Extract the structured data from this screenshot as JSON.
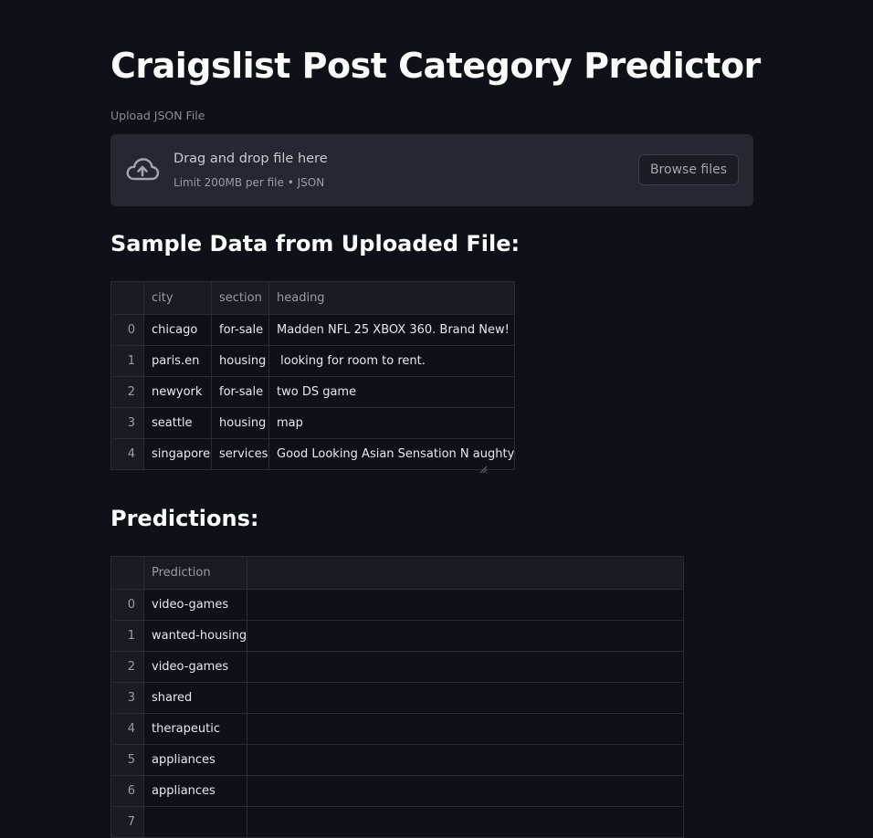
{
  "app": {
    "title": "Craigslist Post Category Predictor"
  },
  "uploader": {
    "label": "Upload JSON File",
    "drop_text": "Drag and drop file here",
    "limit_text": "Limit 200MB per file • JSON",
    "browse_label": "Browse files",
    "icon": "cloud-upload-icon"
  },
  "sample": {
    "heading": "Sample Data from Uploaded File:",
    "columns": [
      "city",
      "section",
      "heading"
    ],
    "rows": [
      {
        "index": "0",
        "city": "chicago",
        "section": "for-sale",
        "heading": "Madden NFL 25 XBOX 360. Brand New!"
      },
      {
        "index": "1",
        "city": "paris.en",
        "section": "housing",
        "heading": " looking for room to rent."
      },
      {
        "index": "2",
        "city": "newyork",
        "section": "for-sale",
        "heading": "two DS game"
      },
      {
        "index": "3",
        "city": "seattle",
        "section": "housing",
        "heading": "map"
      },
      {
        "index": "4",
        "city": "singapore",
        "section": "services",
        "heading": "Good Looking Asian Sensation N aughty"
      }
    ]
  },
  "predictions": {
    "heading": "Predictions:",
    "columns": [
      "Prediction"
    ],
    "rows": [
      {
        "index": "0",
        "value": "video-games"
      },
      {
        "index": "1",
        "value": "wanted-housing"
      },
      {
        "index": "2",
        "value": "video-games"
      },
      {
        "index": "3",
        "value": "shared"
      },
      {
        "index": "4",
        "value": "therapeutic"
      },
      {
        "index": "5",
        "value": "appliances"
      },
      {
        "index": "6",
        "value": "appliances"
      },
      {
        "index": "7",
        "value": ""
      }
    ]
  },
  "colors": {
    "background": "#0e1117",
    "dropzone": "#262730",
    "text": "#fafafa",
    "muted": "#9a9ca5"
  }
}
